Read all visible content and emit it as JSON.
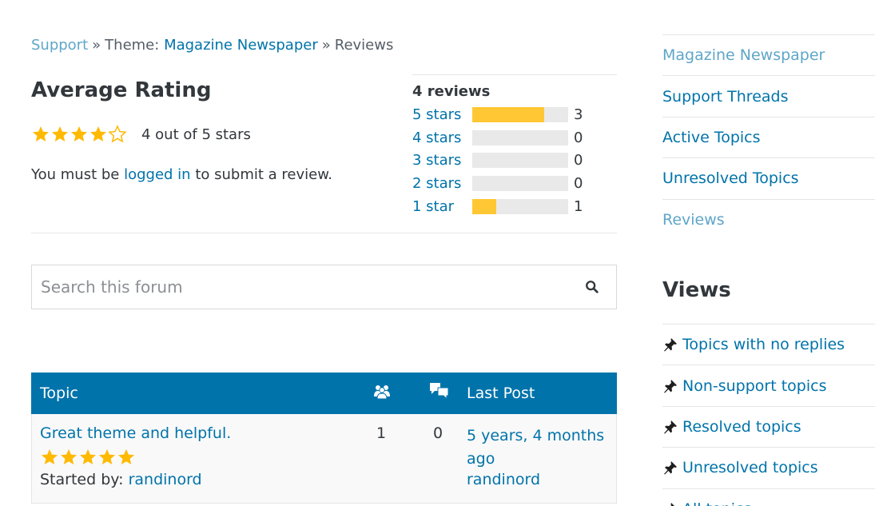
{
  "breadcrumb": {
    "support": "Support",
    "sep1": "»",
    "theme_prefix": "Theme:",
    "theme_name": "Magazine Newspaper",
    "sep2": "»",
    "current": "Reviews"
  },
  "rating": {
    "title": "Average Rating",
    "stars": 4,
    "max_stars": 5,
    "text": "4 out of 5 stars",
    "login_prefix": "You must be",
    "login_link": "logged in",
    "login_suffix": "to submit a review."
  },
  "counts": {
    "title": "4 reviews",
    "rows": [
      {
        "label": "5 stars",
        "count": "3",
        "fraction": 0.75
      },
      {
        "label": "4 stars",
        "count": "0",
        "fraction": 0
      },
      {
        "label": "3 stars",
        "count": "0",
        "fraction": 0
      },
      {
        "label": "2 stars",
        "count": "0",
        "fraction": 0
      },
      {
        "label": "1 star",
        "count": "1",
        "fraction": 0.25
      }
    ]
  },
  "search": {
    "placeholder": "Search this forum",
    "icon": "search-icon"
  },
  "topics": {
    "header": {
      "topic": "Topic",
      "voices_icon": "users-icon",
      "replies_icon": "replies-icon",
      "last_post": "Last Post"
    },
    "rows": [
      {
        "title": "Great theme and helpful.",
        "stars": 5,
        "started_by_label": "Started by:",
        "started_by": "randinord",
        "voices": "1",
        "replies": "0",
        "freshness": "5 years, 4 months ago",
        "last_author": "randinord"
      }
    ]
  },
  "sidebar": {
    "nav": [
      {
        "label": "Magazine Newspaper",
        "active": true
      },
      {
        "label": "Support Threads",
        "active": false
      },
      {
        "label": "Active Topics",
        "active": false
      },
      {
        "label": "Unresolved Topics",
        "active": false
      },
      {
        "label": "Reviews",
        "active": true
      }
    ],
    "views_title": "Views",
    "views": [
      {
        "label": "Topics with no replies"
      },
      {
        "label": "Non-support topics"
      },
      {
        "label": "Resolved topics"
      },
      {
        "label": "Unresolved topics"
      },
      {
        "label": "All topics"
      }
    ]
  },
  "colors": {
    "link": "#0073aa",
    "link_light": "#5fa6c8",
    "star": "#ffb900",
    "bar_fill": "#ffc733",
    "header_bg": "#0073aa"
  }
}
